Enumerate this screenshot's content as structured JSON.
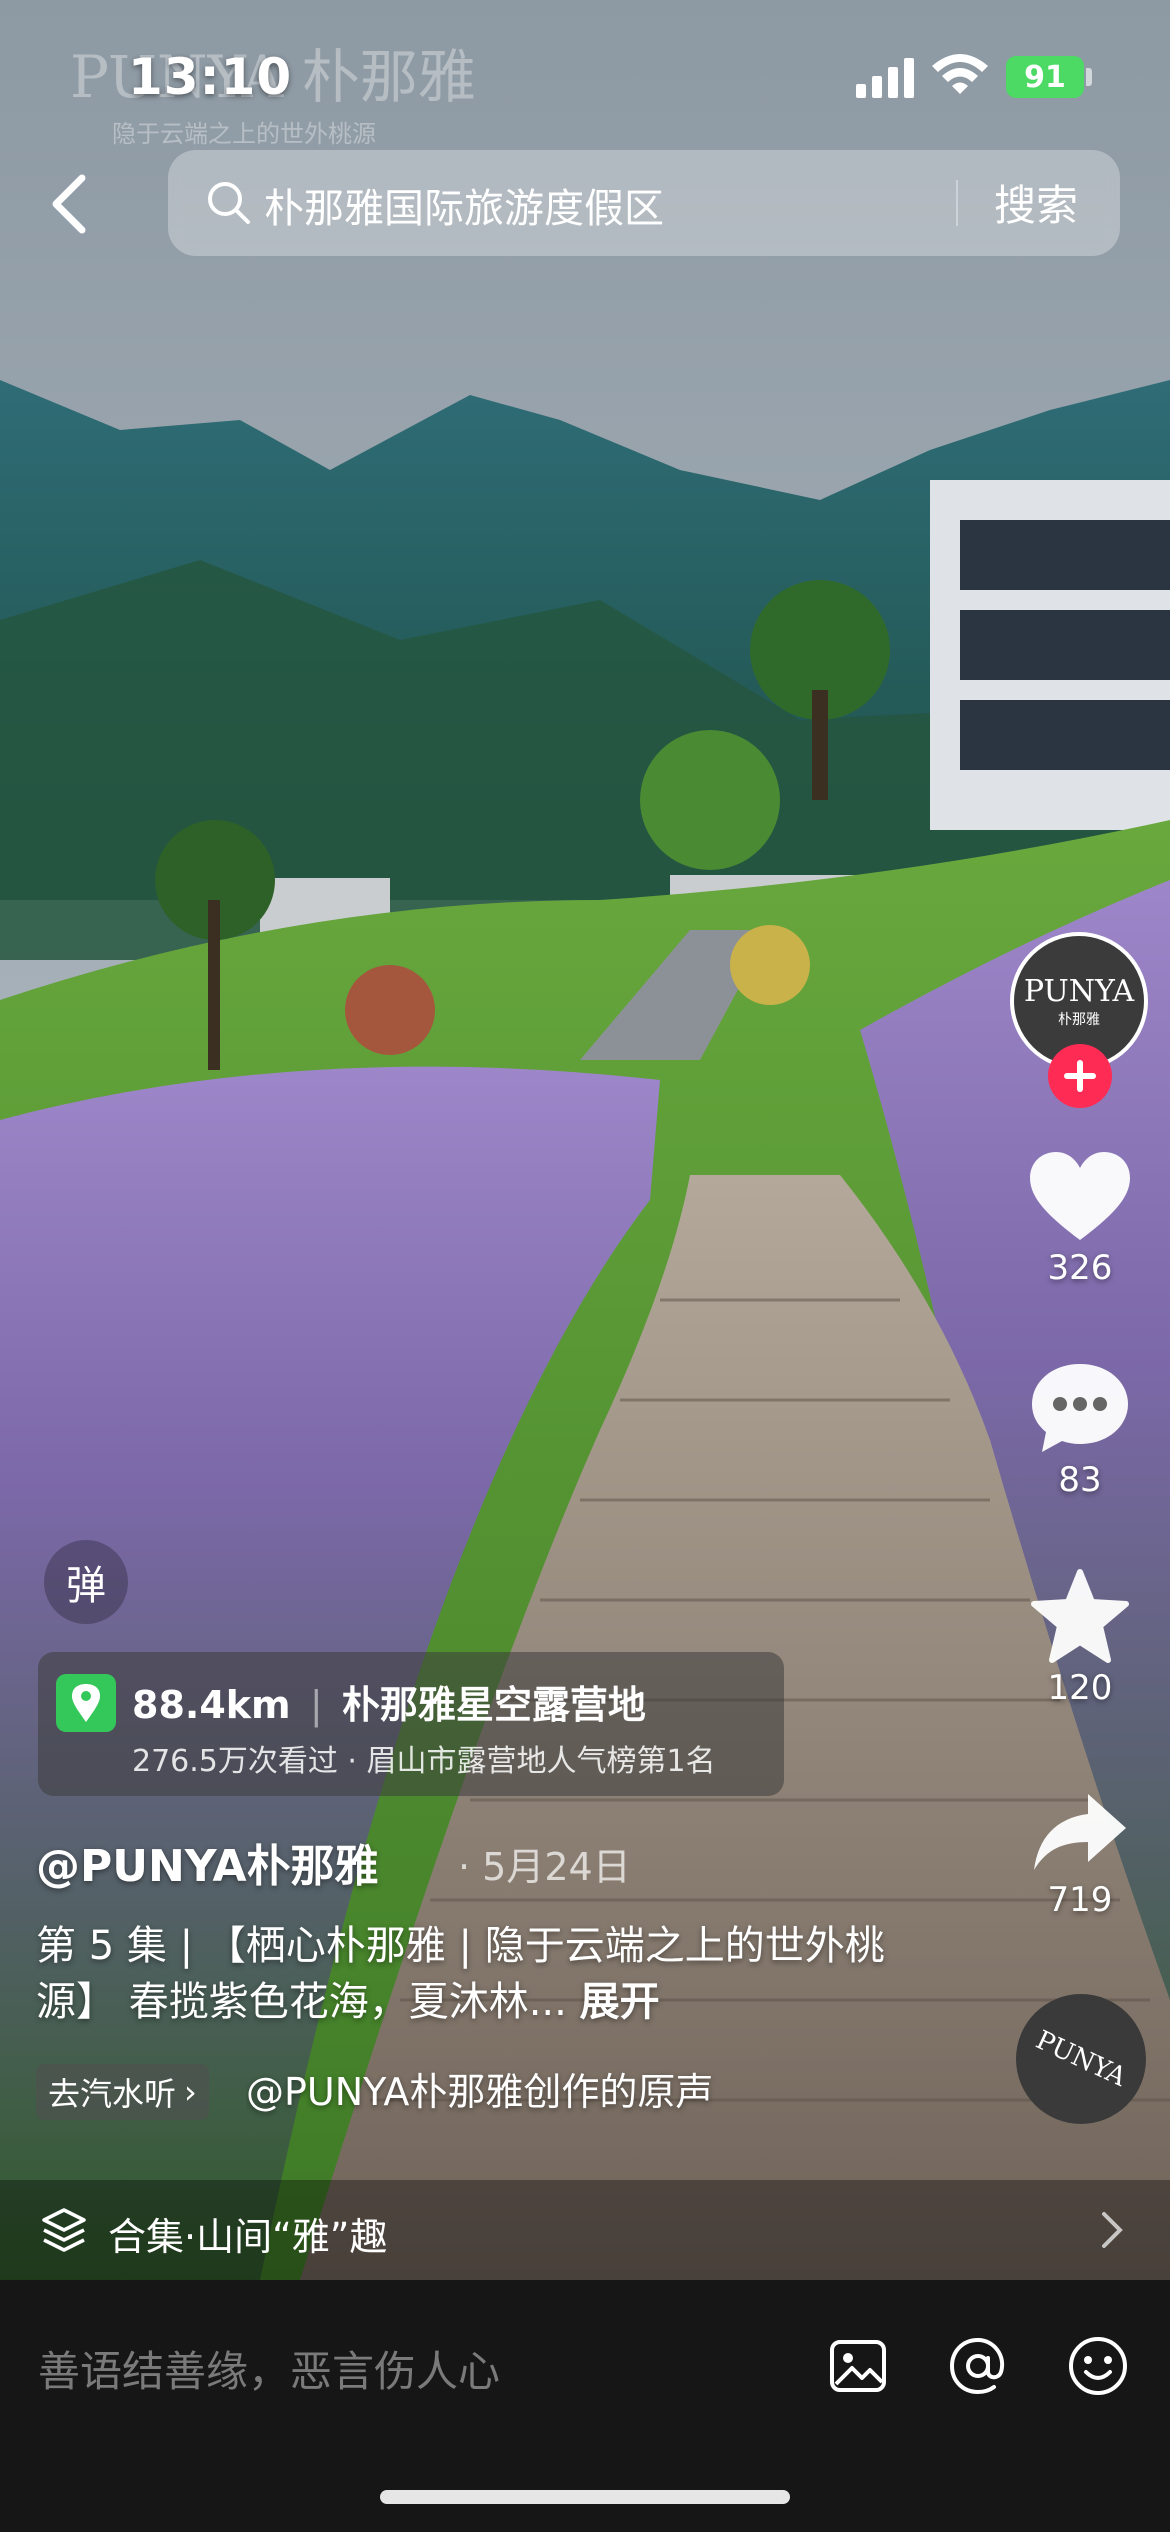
{
  "status_bar": {
    "time": "13:10",
    "battery": "91"
  },
  "watermark": {
    "brand": "PUNYA 朴那雅",
    "tagline": "隐于云端之上的世外桃源"
  },
  "search": {
    "query": "朴那雅国际旅游度假区",
    "button_label": "搜索"
  },
  "actions": {
    "likes": "326",
    "comments": "83",
    "favorites": "120",
    "shares": "719"
  },
  "avatar": {
    "brand": "PUNYA",
    "sub": "朴那雅"
  },
  "danmaku_label": "弹",
  "location": {
    "distance": "88.4km",
    "name": "朴那雅星空露营地",
    "detail": "276.5万次看过 · 眉山市露营地人气榜第1名"
  },
  "post": {
    "author": "@PUNYA朴那雅",
    "date": "· 5月24日",
    "description": "第 5 集 | 【栖心朴那雅 | 隐于云端之上的世外桃源】 春揽紫色花海，夏沐林...",
    "expand_label": "展开"
  },
  "music": {
    "tag": "去汽水听",
    "text": "@PUNYA朴那雅创作的原声"
  },
  "collection": {
    "label": "合集·山间“雅”趣"
  },
  "comment_bar": {
    "placeholder": "善语结善缘，恶言伤人心"
  },
  "colors": {
    "like": "#ffffff",
    "follow": "#fe2c55",
    "location_pin": "#34c759",
    "battery": "#4cd964"
  }
}
